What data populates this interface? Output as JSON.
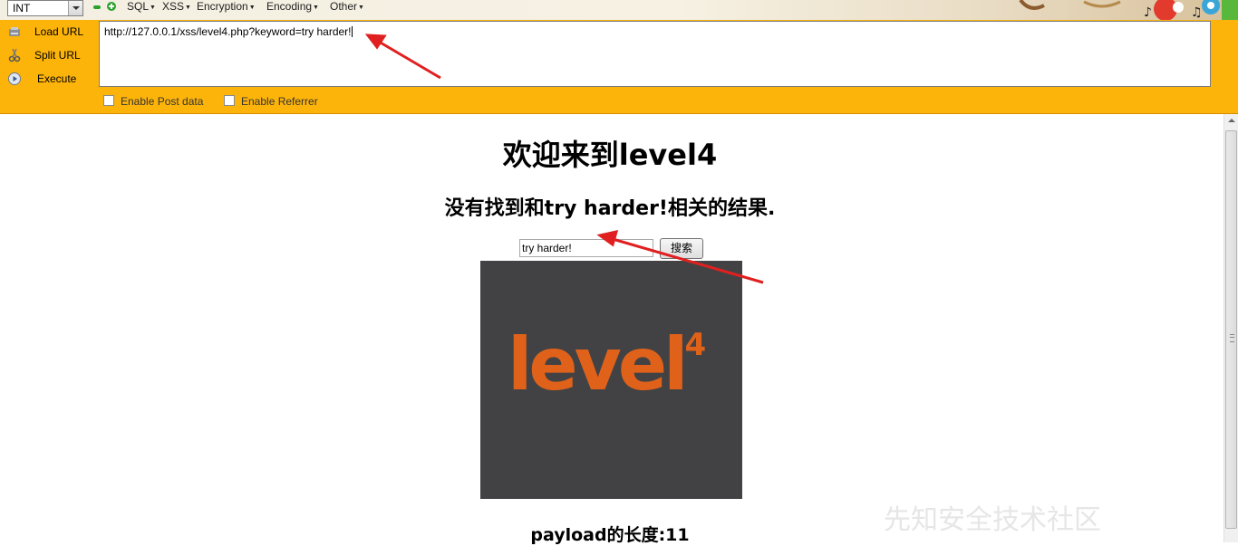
{
  "hackbar": {
    "select_value": "INT",
    "menus": [
      "SQL",
      "XSS",
      "Encryption",
      "Encoding",
      "Other"
    ],
    "side_items": [
      {
        "label": "Load URL",
        "icon": "load-url-icon"
      },
      {
        "label": "Split URL",
        "icon": "scissors-icon"
      },
      {
        "label": "Execute",
        "icon": "execute-icon"
      }
    ],
    "url_value": "http://127.0.0.1/xss/level4.php?keyword=try harder!",
    "enable_post": "Enable Post data",
    "enable_referrer": "Enable Referrer"
  },
  "page": {
    "heading": "欢迎来到level4",
    "result_text": "没有找到和try harder!相关的结果.",
    "search_value": "try harder!",
    "search_button": "搜索",
    "level_image": {
      "text": "level",
      "sup": "4",
      "background": "#424244",
      "text_color": "#e0621a"
    },
    "payload_length": "payload的长度:11"
  },
  "watermark": "先知安全技术社区",
  "colors": {
    "hackbar_orange": "#fdb40a",
    "annotation_arrow": "#e02020"
  }
}
